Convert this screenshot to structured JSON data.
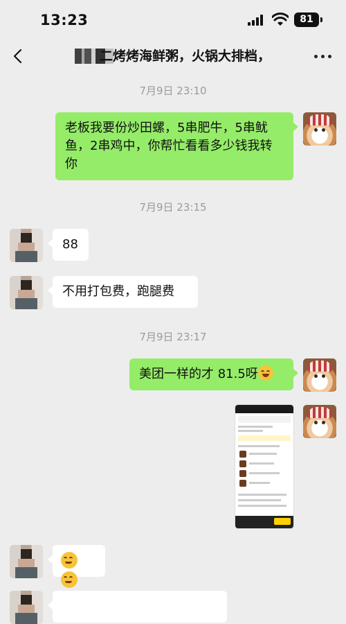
{
  "status": {
    "time": "13:23",
    "battery": "81"
  },
  "chat": {
    "title": "二烤烤海鲜粥，火锅大排档，"
  },
  "messages": {
    "ts1": "7月9日 23:10",
    "m1": "老板我要份炒田螺，5串肥牛，5串鱿鱼，2串鸡中，你帮忙看看多少钱我转你",
    "ts2": "7月9日 23:15",
    "m2": "88",
    "m3": "不用打包费，跑腿费",
    "ts3": "7月9日 23:17",
    "m4": "美团一样的才 81.5呀"
  },
  "icons": [
    "back-icon",
    "more-icon",
    "signal-icon",
    "wifi-icon",
    "battery-icon",
    "grin-emoji-icon",
    "smile-emoji-icon"
  ],
  "colors": {
    "background": "#EDEDED",
    "my_bubble": "#95EC69",
    "their_bubble": "#FFFFFF",
    "timestamp": "#9B9B9B"
  }
}
